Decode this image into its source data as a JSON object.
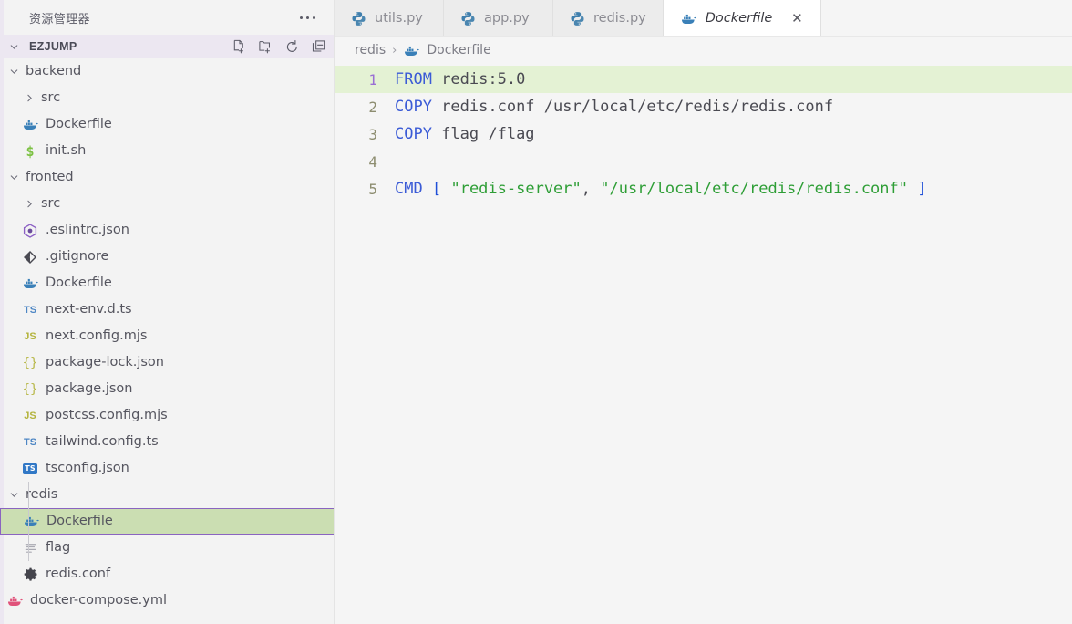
{
  "sidebar": {
    "panel_title": "资源管理器",
    "more_icon": "ellipsis-icon",
    "section": {
      "label": "EZJUMP",
      "expanded": true,
      "actions": [
        {
          "name": "new-file-icon",
          "title": "New File"
        },
        {
          "name": "new-folder-icon",
          "title": "New Folder"
        },
        {
          "name": "refresh-icon",
          "title": "Refresh Explorer"
        },
        {
          "name": "collapse-all-icon",
          "title": "Collapse Folders in Explorer"
        }
      ]
    },
    "tree": [
      {
        "label": "backend",
        "type": "folder",
        "state": "expanded",
        "depth": 1,
        "icon": "chevron-down-icon"
      },
      {
        "label": "src",
        "type": "folder",
        "state": "collapsed",
        "depth": 2,
        "icon": "chevron-right-icon"
      },
      {
        "label": "Dockerfile",
        "type": "file",
        "depth": 2,
        "icon": "docker-whale-icon"
      },
      {
        "label": "init.sh",
        "type": "file",
        "depth": 2,
        "icon": "shell-dollar-icon"
      },
      {
        "label": "fronted",
        "type": "folder",
        "state": "expanded",
        "depth": 1,
        "icon": "chevron-down-icon"
      },
      {
        "label": "src",
        "type": "folder",
        "state": "collapsed",
        "depth": 2,
        "icon": "chevron-right-icon"
      },
      {
        "label": ".eslintrc.json",
        "type": "file",
        "depth": 2,
        "icon": "eslint-icon"
      },
      {
        "label": ".gitignore",
        "type": "file",
        "depth": 2,
        "icon": "git-icon"
      },
      {
        "label": "Dockerfile",
        "type": "file",
        "depth": 2,
        "icon": "docker-whale-icon"
      },
      {
        "label": "next-env.d.ts",
        "type": "file",
        "depth": 2,
        "icon": "typescript-icon"
      },
      {
        "label": "next.config.mjs",
        "type": "file",
        "depth": 2,
        "icon": "javascript-icon"
      },
      {
        "label": "package-lock.json",
        "type": "file",
        "depth": 2,
        "icon": "json-icon"
      },
      {
        "label": "package.json",
        "type": "file",
        "depth": 2,
        "icon": "json-icon"
      },
      {
        "label": "postcss.config.mjs",
        "type": "file",
        "depth": 2,
        "icon": "javascript-icon"
      },
      {
        "label": "tailwind.config.ts",
        "type": "file",
        "depth": 2,
        "icon": "typescript-icon"
      },
      {
        "label": "tsconfig.json",
        "type": "file",
        "depth": 2,
        "icon": "tsconfig-icon"
      },
      {
        "label": "redis",
        "type": "folder",
        "state": "expanded",
        "depth": 1,
        "icon": "chevron-down-icon"
      },
      {
        "label": "Dockerfile",
        "type": "file",
        "depth": 2,
        "icon": "docker-whale-icon",
        "selected": true
      },
      {
        "label": "flag",
        "type": "file",
        "depth": 2,
        "icon": "plaintext-icon"
      },
      {
        "label": "redis.conf",
        "type": "file",
        "depth": 2,
        "icon": "gear-icon"
      },
      {
        "label": "docker-compose.yml",
        "type": "file",
        "depth": 1,
        "icon": "docker-compose-icon"
      }
    ]
  },
  "tabs": [
    {
      "label": "utils.py",
      "icon": "python-icon",
      "active": false
    },
    {
      "label": "app.py",
      "icon": "python-icon",
      "active": false
    },
    {
      "label": "redis.py",
      "icon": "python-icon",
      "active": false
    },
    {
      "label": "Dockerfile",
      "icon": "docker-whale-icon",
      "active": true,
      "close_icon": "close-icon",
      "close_label": "✕"
    }
  ],
  "breadcrumb": {
    "separator": "›",
    "items": [
      {
        "label": "redis",
        "icon": null
      },
      {
        "label": "Dockerfile",
        "icon": "docker-whale-icon"
      }
    ]
  },
  "editor": {
    "language": "dockerfile",
    "active_line": 1,
    "lines": [
      {
        "num": "1",
        "active": true,
        "tokens": [
          {
            "t": "FROM",
            "c": "k"
          },
          {
            "t": " redis:5.0",
            "c": "t"
          }
        ]
      },
      {
        "num": "2",
        "active": false,
        "tokens": [
          {
            "t": "COPY",
            "c": "k"
          },
          {
            "t": " redis.conf /usr/local/etc/redis/redis.conf",
            "c": "t"
          }
        ]
      },
      {
        "num": "3",
        "active": false,
        "tokens": [
          {
            "t": "COPY",
            "c": "k"
          },
          {
            "t": " flag /flag",
            "c": "t"
          }
        ]
      },
      {
        "num": "4",
        "active": false,
        "tokens": []
      },
      {
        "num": "5",
        "active": false,
        "tokens": [
          {
            "t": "CMD",
            "c": "k"
          },
          {
            "t": " ",
            "c": "t"
          },
          {
            "t": "[",
            "c": "p"
          },
          {
            "t": " ",
            "c": "t"
          },
          {
            "t": "\"redis-server\"",
            "c": "s"
          },
          {
            "t": ", ",
            "c": "t"
          },
          {
            "t": "\"/usr/local/etc/redis/redis.conf\"",
            "c": "s"
          },
          {
            "t": " ",
            "c": "t"
          },
          {
            "t": "]",
            "c": "p"
          }
        ]
      }
    ]
  },
  "colors": {
    "selection_bg": "#cbdeb2",
    "selection_border": "#8a64c0",
    "active_line_bg": "#e4f2d4",
    "section_header_bg": "#ece7f1",
    "keyword": "#3b5bd6",
    "string": "#2e9e36",
    "punctuation": "#1f4fd8",
    "active_linenumber": "#9a6fd4"
  }
}
